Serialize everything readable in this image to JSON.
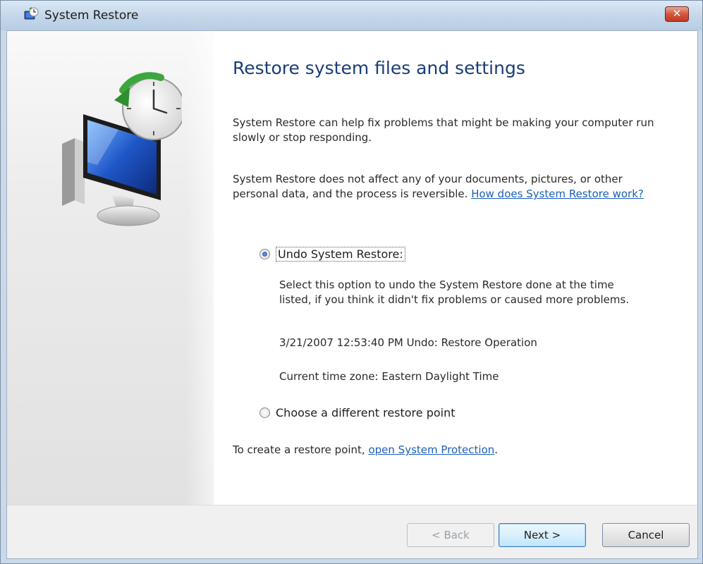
{
  "window": {
    "title": "System Restore",
    "close_label": "✕"
  },
  "main": {
    "heading": "Restore system files and settings",
    "para1": "System Restore can help fix problems that might be making your computer run slowly or stop responding.",
    "para2_text": "System Restore does not affect any of your documents, pictures, or other personal data, and the process is reversible. ",
    "para2_link": "How does System Restore work?",
    "options": [
      {
        "label": "Undo System Restore:",
        "selected": true,
        "description": "Select this option to undo the System Restore done at the time listed, if you think it didn't fix problems or caused more problems.",
        "restore_point": "3/21/2007 12:53:40 PM Undo: Restore Operation",
        "time_zone": "Current time zone: Eastern Daylight Time"
      },
      {
        "label": "Choose a different restore point",
        "selected": false
      }
    ],
    "footer_text": "To create a restore point, ",
    "footer_link": "open System Protection",
    "footer_period": "."
  },
  "buttons": {
    "back": "< Back",
    "next": "Next >",
    "cancel": "Cancel"
  },
  "icons": {
    "title_icon": "system-restore-icon",
    "hero_icon": "system-restore-clock-monitor-icon"
  }
}
